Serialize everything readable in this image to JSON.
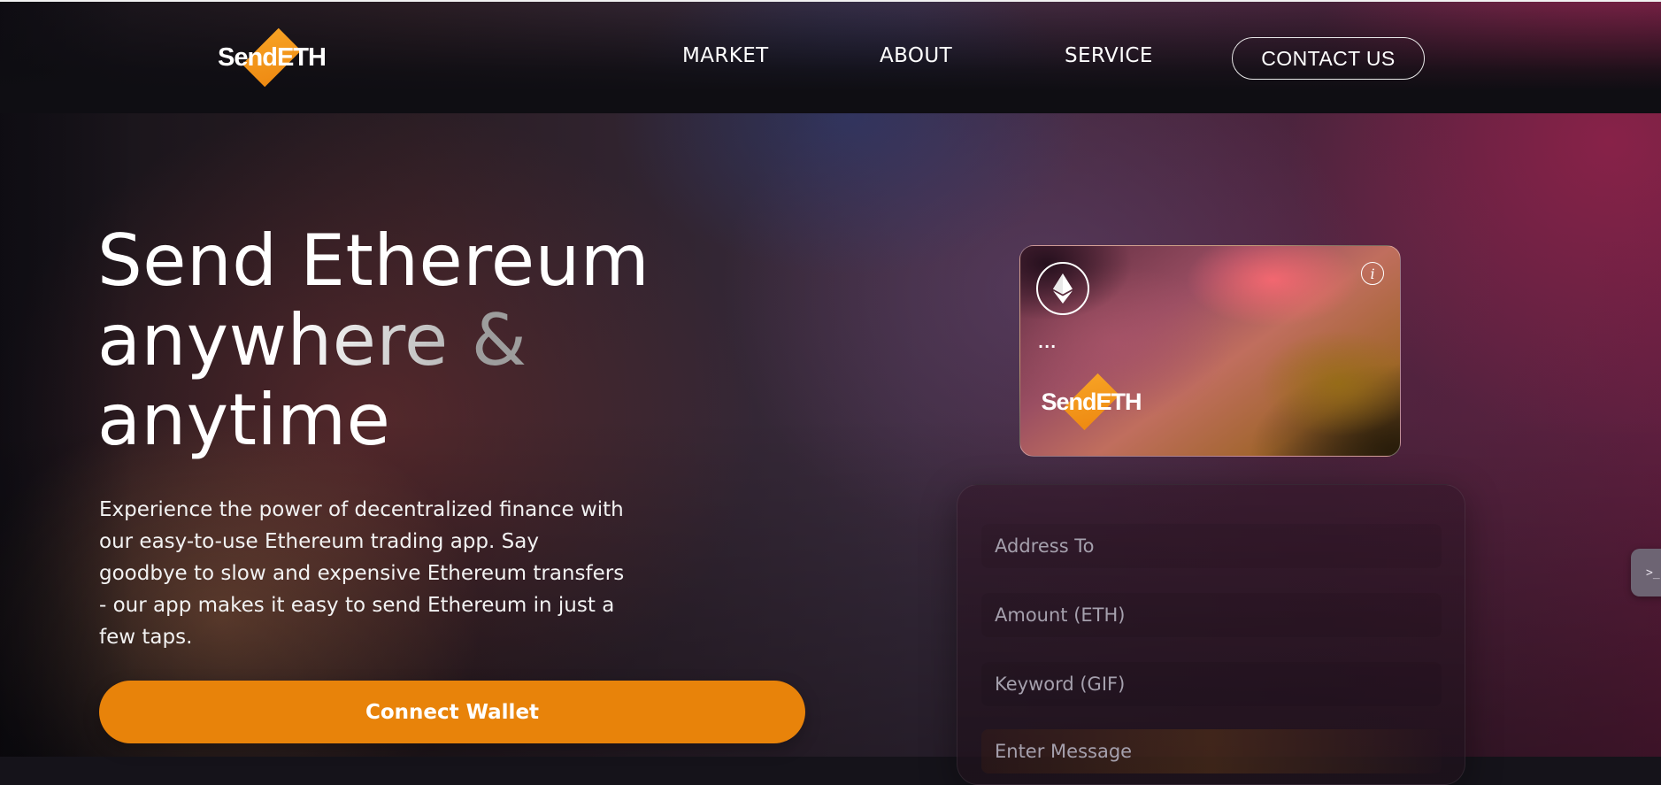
{
  "brand": {
    "logo_text": "SendETH",
    "accent_color": "#e8830a"
  },
  "nav": {
    "links": [
      "MARKET",
      "ABOUT",
      "SERVICE"
    ],
    "contact_label": "CONTACT US"
  },
  "hero": {
    "title_line1": "Send Ethereum",
    "title_line2_word": "anywhere",
    "title_line2_amp": "&",
    "title_line3": "anytime",
    "description": "Experience the power of decentralized finance with our easy-to-use Ethereum trading app. Say goodbye to slow and expensive Ethereum transfers - our app makes it easy to send Ethereum in just a few taps.",
    "cta_label": "Connect Wallet"
  },
  "card": {
    "eth_icon": "ethereum-icon",
    "info_icon": "info-icon",
    "address_text": "...",
    "logo_text": "SendETH"
  },
  "form": {
    "address_placeholder": "Address To",
    "amount_placeholder": "Amount (ETH)",
    "keyword_placeholder": "Keyword (GIF)",
    "message_placeholder": "Enter Message"
  },
  "side_tab": {
    "glyph": ">_",
    "icon": "terminal-icon"
  }
}
